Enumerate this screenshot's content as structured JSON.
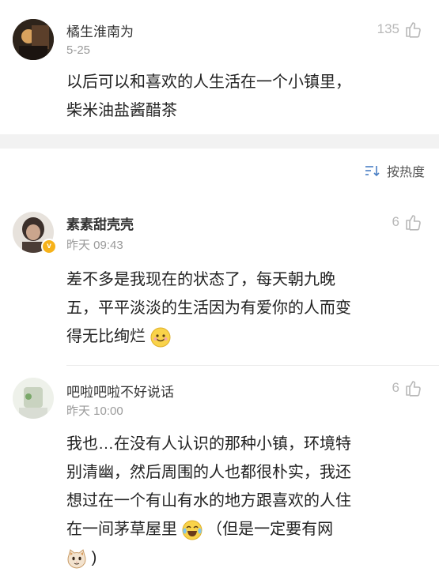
{
  "top_comment": {
    "name": "橘生淮南为",
    "time": "5-25",
    "likes": "135",
    "text_line1": "以后可以和喜欢的人生活在一个小镇里，",
    "text_line2": "柴米油盐酱醋茶"
  },
  "sort": {
    "label": "按热度"
  },
  "replies": [
    {
      "name": "素素甜壳壳",
      "time": "昨天 09:43",
      "likes": "6",
      "verified_badge": "v",
      "line1": "差不多是我现在的状态了，每天朝九晚",
      "line2": "五，平平淡淡的生活因为有爱你的人而变",
      "line3": "得无比绚烂"
    },
    {
      "name": "吧啦吧啦不好说话",
      "time": "昨天 10:00",
      "likes": "6",
      "line1": "我也…在没有人认识的那种小镇，环境特",
      "line2": "别清幽，然后周围的人也都很朴实，我还",
      "line3": "想过在一个有山有水的地方跟喜欢的人住",
      "line4a": "在一间茅草屋里",
      "line4b": "（但是一定要有网",
      "line5": ")"
    }
  ],
  "colors": {
    "divider_band": "#f2f2f2",
    "meta_gray": "#9a9a9a",
    "icon_gray": "#b8b8b8"
  }
}
